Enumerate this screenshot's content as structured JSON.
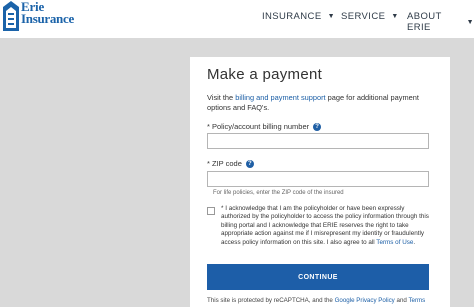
{
  "header": {
    "logo": {
      "line1": "Erie",
      "line2": "Insurance"
    },
    "nav": [
      {
        "label": "INSURANCE",
        "caret": "▼"
      },
      {
        "label": "SERVICE",
        "caret": "▼"
      },
      {
        "label": "ABOUT ERIE",
        "caret": "▼"
      }
    ]
  },
  "form": {
    "title": "Make a payment",
    "intro": {
      "pre": "Visit the ",
      "link": "billing and payment support",
      "post": " page for additional payment options and FAQ's."
    },
    "policy_label": "* Policy/account billing number",
    "policy_value": "",
    "zip_label": "* ZIP code",
    "zip_value": "",
    "zip_hint": "For life policies, enter the ZIP code of the insured",
    "ack": {
      "text": "* I acknowledge that I am the policyholder or have been expressly authorized by the policyholder to access the policy information through this billing portal and I acknowledge that ERIE reserves the right to take appropriate action against me if I misrepresent my identity or fraudulently access policy information on this site. I also agree to all ",
      "link": "Terms of Use",
      "end": "."
    },
    "continue_label": "CONTINUE",
    "captcha": {
      "pre": "This site is protected by reCAPTCHA, and the ",
      "privacy": "Google Privacy Policy",
      "mid": " and ",
      "terms": "Terms"
    }
  },
  "colors": {
    "brand_blue": "#1d5ea8",
    "page_bg": "#d9d9d9",
    "header_bg": "#ffffff"
  }
}
